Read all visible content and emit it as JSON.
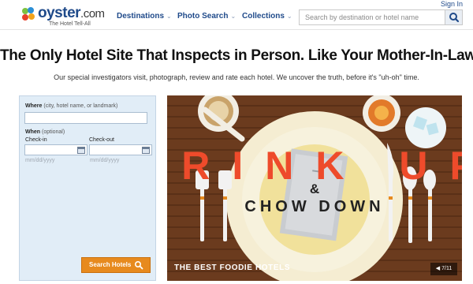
{
  "header": {
    "logo_name": "oyster",
    "logo_tld": ".com",
    "logo_tagline": "The Hotel Tell-All",
    "nav": [
      {
        "label": "Destinations"
      },
      {
        "label": "Photo Search"
      },
      {
        "label": "Collections"
      }
    ],
    "search_placeholder": "Search by destination or hotel name",
    "signin": "Sign In"
  },
  "hero_text": {
    "headline": "The Only Hotel Site That Inspects in Person. Like Your Mother-In-Law.",
    "subline": "Our special investigators visit, photograph, review and rate each hotel. We uncover the truth, before it's \"uh-oh\" time."
  },
  "booking": {
    "where_label": "Where",
    "where_hint": "(city, hotel name, or landmark)",
    "where_value": "",
    "when_label": "When",
    "when_hint": "(optional)",
    "checkin_label": "Check-in",
    "checkout_label": "Check-out",
    "checkin_placeholder": "mm/dd/yyyy",
    "checkout_placeholder": "mm/dd/yyyy",
    "search_button": "Search Hotels"
  },
  "slideshow": {
    "art_word_1": "DRINK UP",
    "art_ampersand": "&",
    "art_word_2": "CHOW DOWN",
    "caption": "THE BEST FOODIE HOTELS",
    "pager": "7/11",
    "colors": {
      "background": "#6b3b1e",
      "title_red": "#ee4b2b",
      "accent_orange": "#e78a1e",
      "brand_blue": "#1f4a8a"
    }
  }
}
